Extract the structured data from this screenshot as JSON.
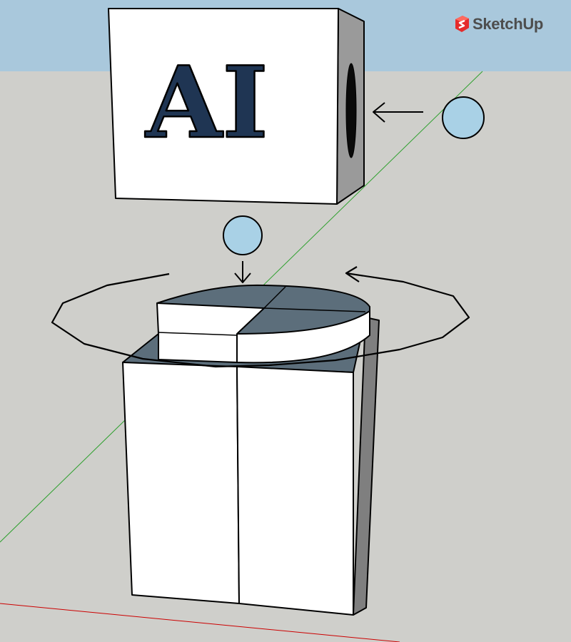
{
  "app": {
    "logo_text": "SketchUp",
    "logo_icon": "sketchup-logo-icon"
  },
  "scene": {
    "cube_label": "AI"
  },
  "colors": {
    "sky": "#a9c8dc",
    "ground": "#cfcfcb",
    "face_white": "#ffffff",
    "face_grey": "#9a9a9a",
    "face_dark_grey": "#7f7f7f",
    "letter_fill": "#1f3553",
    "disc_top": "#5c6e7b",
    "sphere_fill": "#a9d1e6",
    "edge": "#000000",
    "x_axis": "#cc0000",
    "y_axis": "#2ea02e",
    "logo_red": "#e52b2b",
    "logo_text": "#4d4d4d"
  }
}
